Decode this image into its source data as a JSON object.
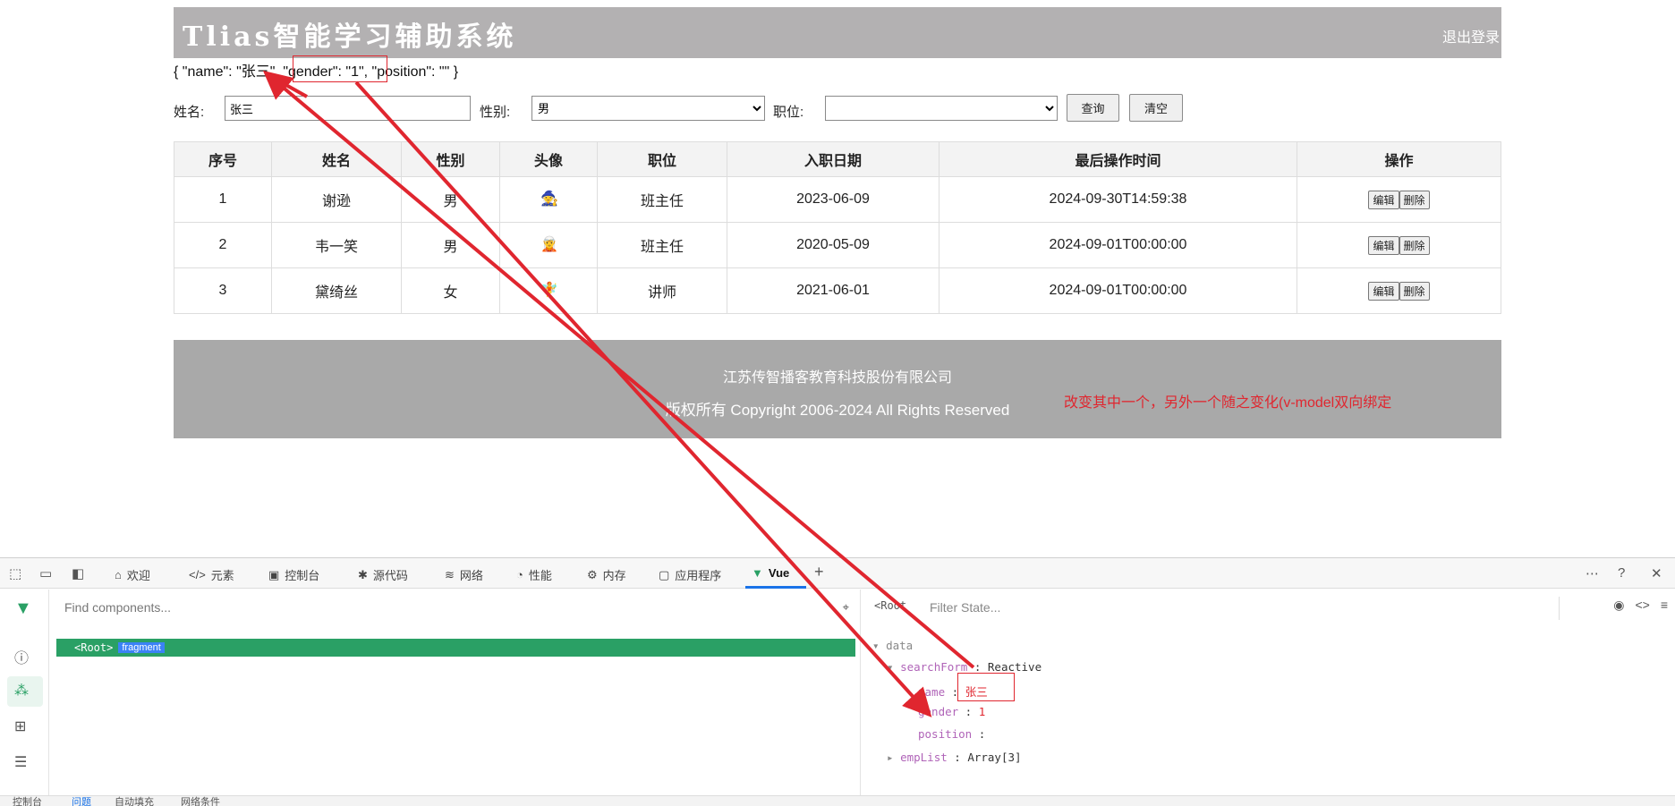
{
  "app": {
    "title": "Tlias智能学习辅助系统",
    "logout": "退出登录",
    "json_preview": "{ \"name\": \"张三\", \"gender\": \"1\", \"position\": \"\" }"
  },
  "search": {
    "name_label": "姓名:",
    "name_value": "张三",
    "gender_label": "性别:",
    "gender_value": "男",
    "position_label": "职位:",
    "position_value": "",
    "query_button": "查询",
    "clear_button": "清空"
  },
  "table": {
    "headers": [
      "序号",
      "姓名",
      "性别",
      "头像",
      "职位",
      "入职日期",
      "最后操作时间",
      "操作"
    ],
    "rows": [
      {
        "no": "1",
        "name": "谢逊",
        "gender": "男",
        "avatar": "🧙",
        "position": "班主任",
        "entry_date": "2023-06-09",
        "update_time": "2024-09-30T14:59:38"
      },
      {
        "no": "2",
        "name": "韦一笑",
        "gender": "男",
        "avatar": "🧝",
        "position": "班主任",
        "entry_date": "2020-05-09",
        "update_time": "2024-09-01T00:00:00"
      },
      {
        "no": "3",
        "name": "黛绮丝",
        "gender": "女",
        "avatar": "🧚",
        "position": "讲师",
        "entry_date": "2021-06-01",
        "update_time": "2024-09-01T00:00:00"
      }
    ],
    "edit_label": "编辑",
    "delete_label": "删除"
  },
  "footer": {
    "company": "江苏传智播客教育科技股份有限公司",
    "copyright": "版权所有 Copyright 2006-2024 All Rights Reserved"
  },
  "annotation": "改变其中一个，另外一个随之变化(v-model双向绑定",
  "devtools": {
    "tabs": [
      {
        "label": "欢迎",
        "icon": "home-icon"
      },
      {
        "label": "元素",
        "icon": "code-icon"
      },
      {
        "label": "控制台",
        "icon": "console-icon"
      },
      {
        "label": "源代码",
        "icon": "bug-icon"
      },
      {
        "label": "网络",
        "icon": "wifi-icon"
      },
      {
        "label": "性能",
        "icon": "gauge-icon"
      },
      {
        "label": "内存",
        "icon": "chip-icon"
      },
      {
        "label": "应用程序",
        "icon": "app-icon"
      },
      {
        "label": "Vue",
        "icon": "vue-icon"
      }
    ],
    "find_placeholder": "Find components...",
    "root_component": "<Root>",
    "fragment_badge": "fragment",
    "root_tag": "<Root",
    "filter_placeholder": "Filter State...",
    "state": {
      "section": "data",
      "search_form_key": "searchForm",
      "search_form_type": "Reactive",
      "name_key": "name",
      "name_value": "张三",
      "gender_key": "gender",
      "gender_value": "1",
      "position_key": "position",
      "position_value": "",
      "emplist_key": "empList",
      "emplist_value": "Array[3]"
    },
    "bottom_tabs": [
      "控制台",
      "问题",
      "自动填充",
      "网络条件"
    ]
  },
  "colors": {
    "header_bg": "#b3b1b2",
    "footer_bg": "#a9a9a9",
    "annotation_red": "#e0262f",
    "vue_green": "#2aa065"
  }
}
